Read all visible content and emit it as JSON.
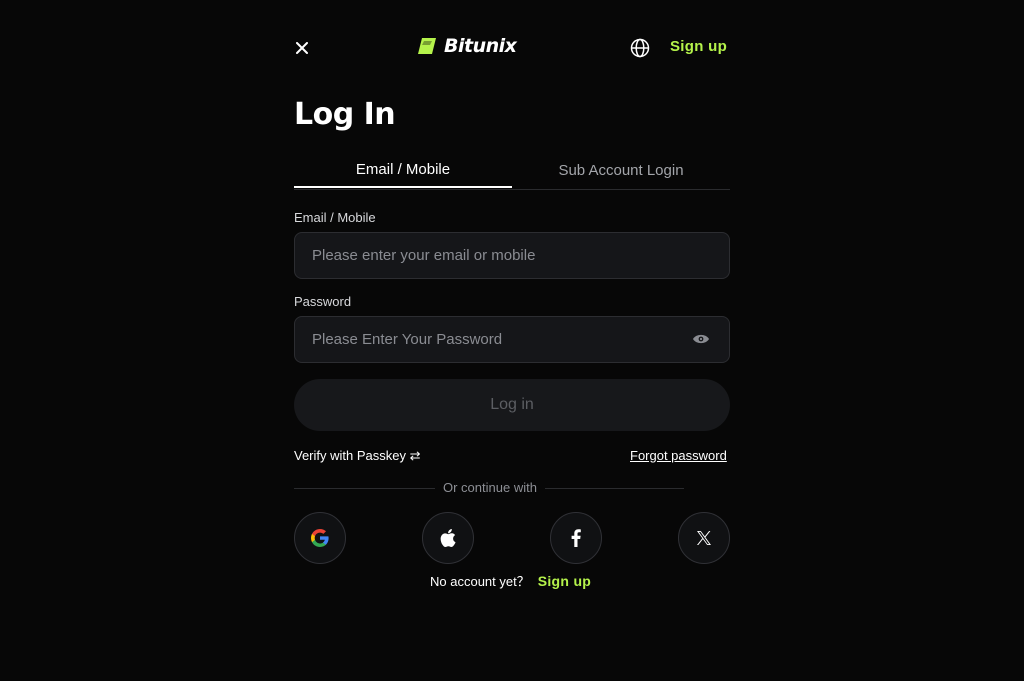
{
  "header": {
    "brand_name": "Bitunix",
    "signup_label": "Sign up"
  },
  "title": "Log In",
  "tabs": [
    {
      "label": "Email / Mobile",
      "active": true
    },
    {
      "label": "Sub Account Login",
      "active": false
    }
  ],
  "email_field": {
    "label": "Email / Mobile",
    "placeholder": "Please enter your email or mobile",
    "value": ""
  },
  "password_field": {
    "label": "Password",
    "placeholder": "Please Enter Your Password",
    "value": ""
  },
  "login_button_label": "Log in",
  "passkey_label": "Verify with Passkey ⇄",
  "forgot_label": "Forgot password",
  "divider_text": "Or continue with",
  "social_icons": [
    "google-icon",
    "apple-icon",
    "facebook-icon",
    "x-icon"
  ],
  "footer": {
    "prompt": "No account yet？",
    "signup_label": "Sign up"
  },
  "colors": {
    "accent": "#b5f34b",
    "background": "#070707",
    "input_bg": "#151619"
  }
}
